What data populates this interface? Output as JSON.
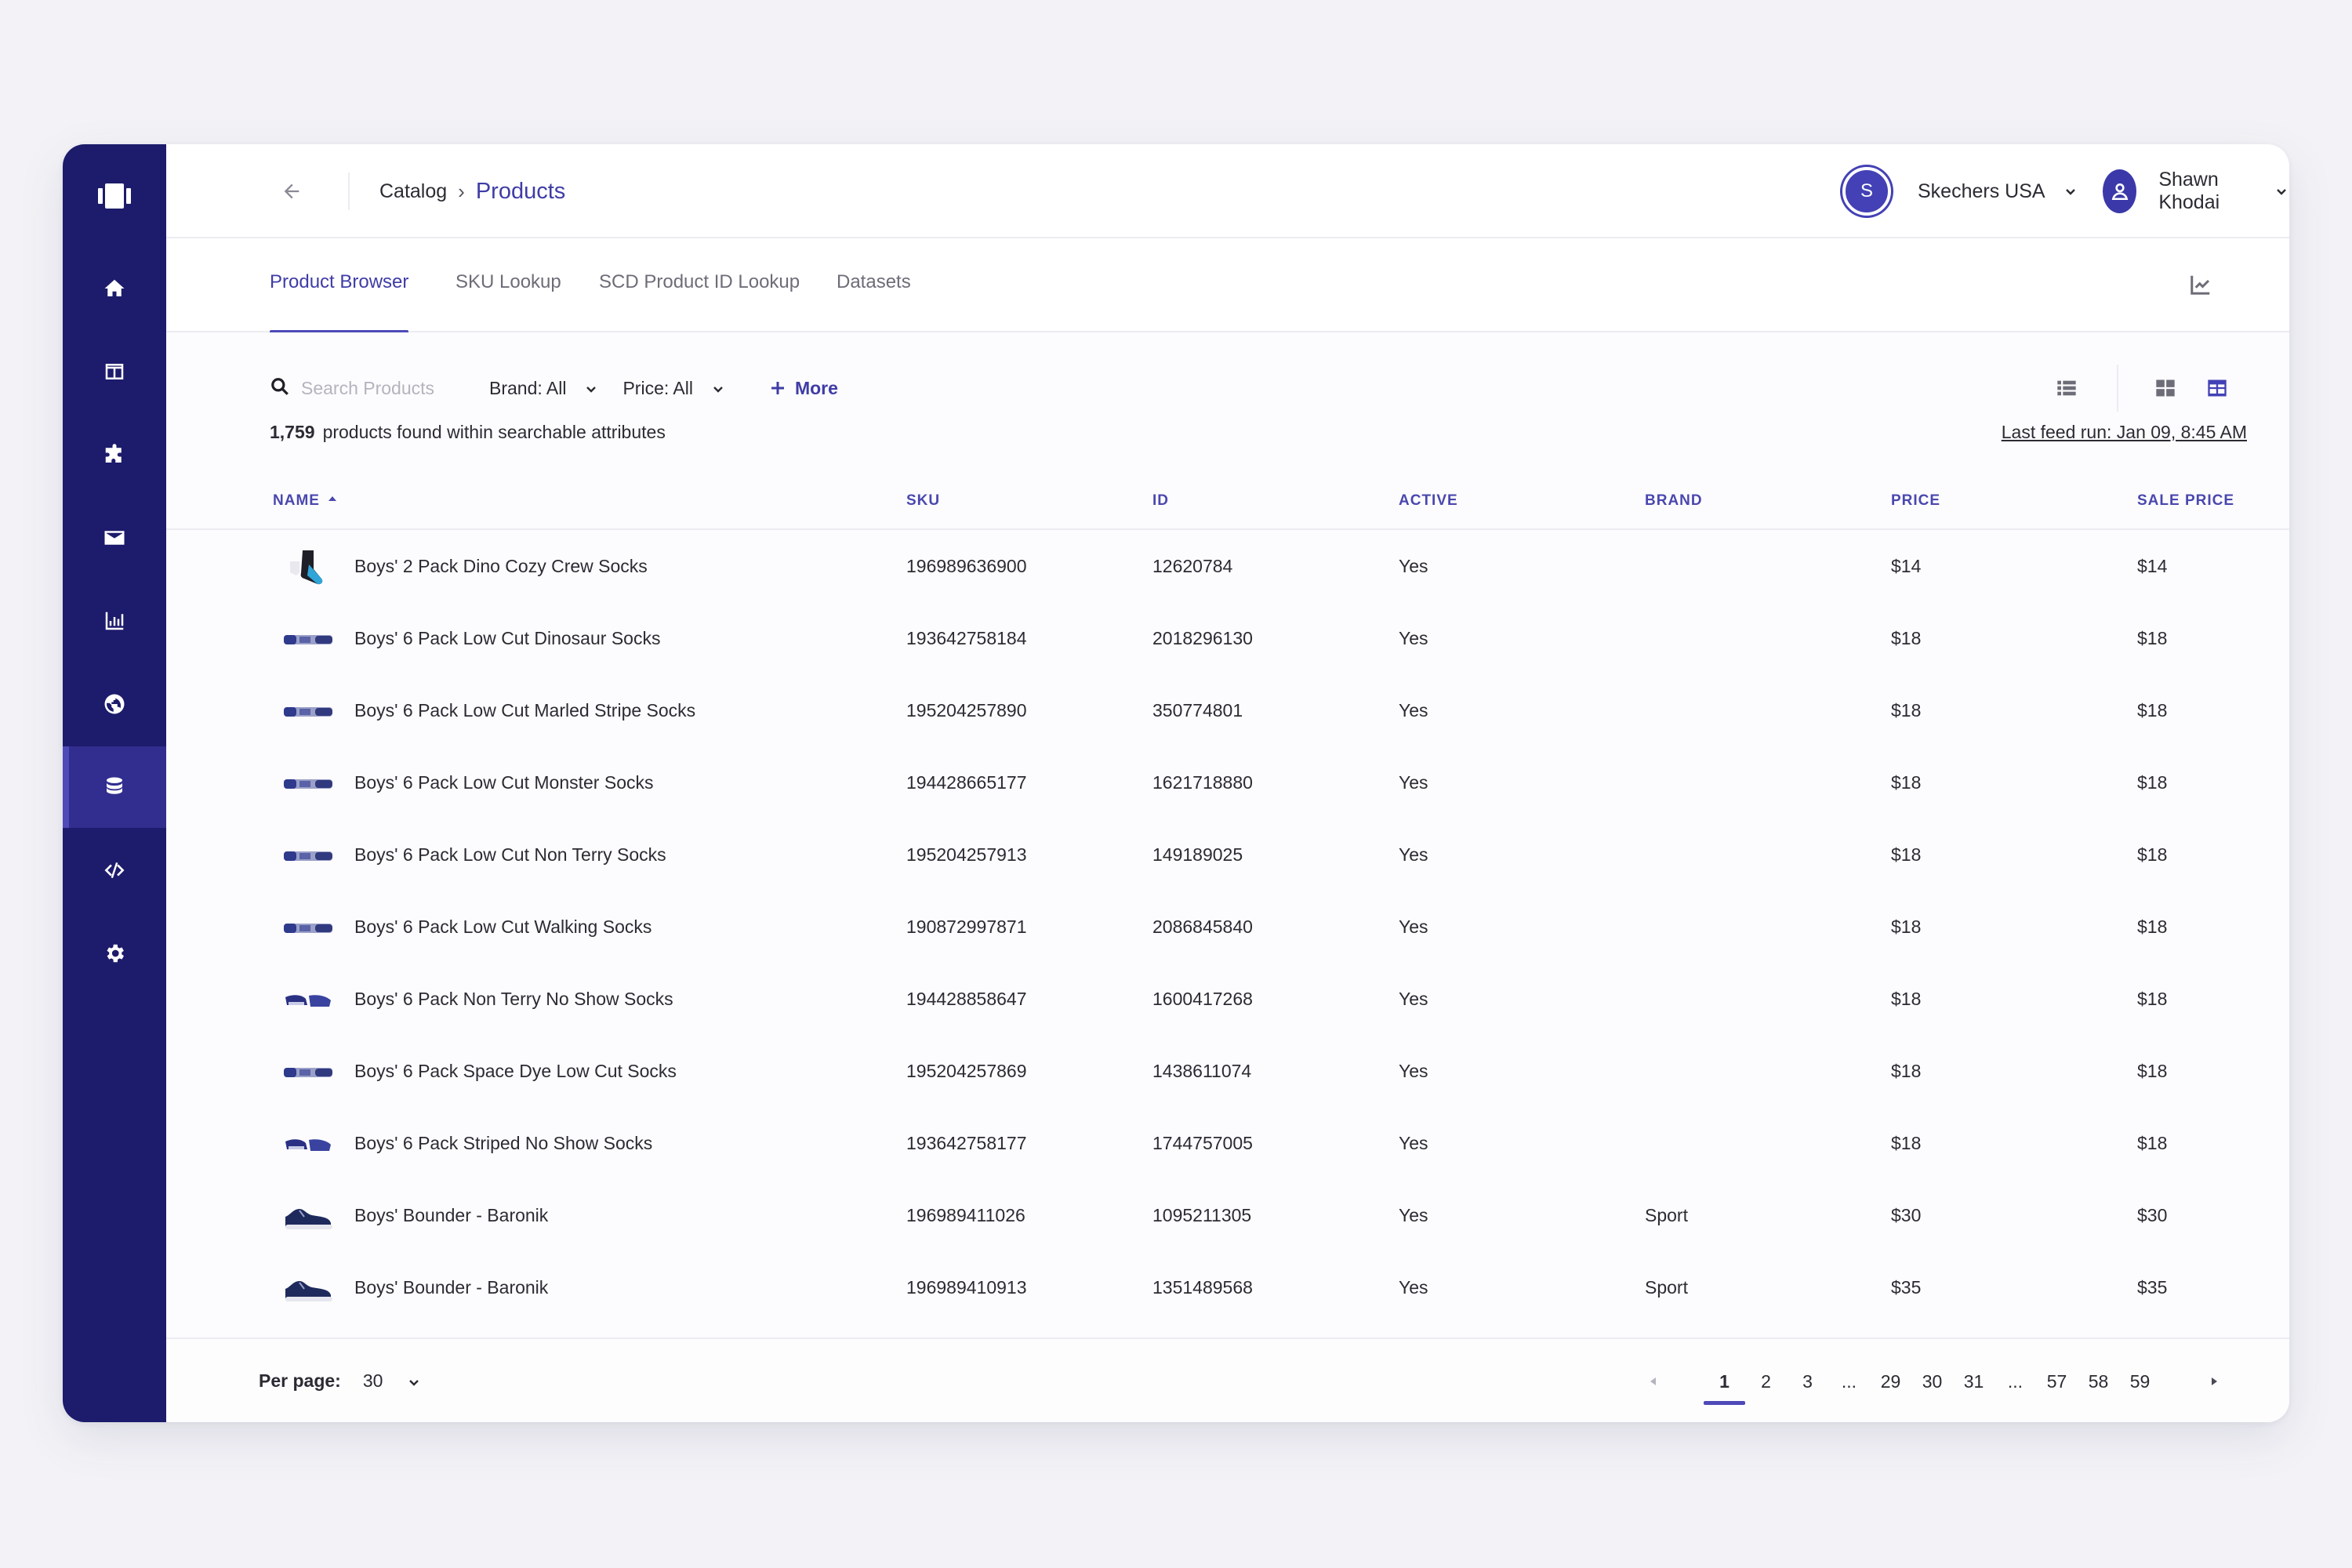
{
  "header": {
    "breadcrumb_parent": "Catalog",
    "breadcrumb_sep": "›",
    "breadcrumb_current": "Products",
    "org_initial": "S",
    "org_name": "Skechers USA",
    "user_name": "Shawn Khodai"
  },
  "tabs": [
    {
      "label": "Product Browser"
    },
    {
      "label": "SKU Lookup"
    },
    {
      "label": "SCD Product ID Lookup"
    },
    {
      "label": "Datasets"
    }
  ],
  "toolbar": {
    "search_placeholder": "Search Products",
    "brand_filter": "Brand: All",
    "price_filter": "Price: All",
    "more_label": "More"
  },
  "summary": {
    "count": "1,759",
    "text": "products found within searchable attributes",
    "last_feed": "Last feed run: Jan 09, 8:45 AM"
  },
  "columns": [
    "NAME",
    "SKU",
    "ID",
    "ACTIVE",
    "BRAND",
    "PRICE",
    "SALE PRICE"
  ],
  "rows": [
    {
      "name": "Boys' 2 Pack Dino Cozy Crew Socks",
      "sku": "196989636900",
      "id": "12620784",
      "active": "Yes",
      "brand": "",
      "price": "$14",
      "sale_price": "$14"
    },
    {
      "name": "Boys' 6 Pack Low Cut Dinosaur Socks",
      "sku": "193642758184",
      "id": "2018296130",
      "active": "Yes",
      "brand": "",
      "price": "$18",
      "sale_price": "$18"
    },
    {
      "name": "Boys' 6 Pack Low Cut Marled Stripe Socks",
      "sku": "195204257890",
      "id": "350774801",
      "active": "Yes",
      "brand": "",
      "price": "$18",
      "sale_price": "$18"
    },
    {
      "name": "Boys' 6 Pack Low Cut Monster Socks",
      "sku": "194428665177",
      "id": "1621718880",
      "active": "Yes",
      "brand": "",
      "price": "$18",
      "sale_price": "$18"
    },
    {
      "name": "Boys' 6 Pack Low Cut Non Terry Socks",
      "sku": "195204257913",
      "id": "149189025",
      "active": "Yes",
      "brand": "",
      "price": "$18",
      "sale_price": "$18"
    },
    {
      "name": "Boys' 6 Pack Low Cut Walking Socks",
      "sku": "190872997871",
      "id": "2086845840",
      "active": "Yes",
      "brand": "",
      "price": "$18",
      "sale_price": "$18"
    },
    {
      "name": "Boys' 6 Pack Non Terry No Show Socks",
      "sku": "194428858647",
      "id": "1600417268",
      "active": "Yes",
      "brand": "",
      "price": "$18",
      "sale_price": "$18"
    },
    {
      "name": "Boys' 6 Pack Space Dye Low Cut Socks",
      "sku": "195204257869",
      "id": "1438611074",
      "active": "Yes",
      "brand": "",
      "price": "$18",
      "sale_price": "$18"
    },
    {
      "name": "Boys' 6 Pack Striped No Show Socks",
      "sku": "193642758177",
      "id": "1744757005",
      "active": "Yes",
      "brand": "",
      "price": "$18",
      "sale_price": "$18"
    },
    {
      "name": "Boys' Bounder - Baronik",
      "sku": "196989411026",
      "id": "1095211305",
      "active": "Yes",
      "brand": "Sport",
      "price": "$30",
      "sale_price": "$30"
    },
    {
      "name": "Boys' Bounder - Baronik",
      "sku": "196989410913",
      "id": "1351489568",
      "active": "Yes",
      "brand": "Sport",
      "price": "$35",
      "sale_price": "$35"
    }
  ],
  "footer": {
    "per_page_label": "Per page:",
    "per_page_value": "30",
    "pages": [
      "1",
      "2",
      "3",
      "...",
      "29",
      "30",
      "31",
      "...",
      "57",
      "58",
      "59"
    ],
    "current_page": "1"
  },
  "colors": {
    "sidebar": "#1d1b6b",
    "accent": "#3f3ca6"
  },
  "icons": {
    "sidebar": [
      "logo-icon",
      "home-icon",
      "layout-icon",
      "puzzle-icon",
      "mail-icon",
      "bar-chart-icon",
      "globe-icon",
      "database-icon",
      "code-icon",
      "gear-icon"
    ],
    "thumbnails": [
      "crew-sock-icon",
      "low-cut-sock-icon",
      "low-cut-sock-icon",
      "low-cut-sock-icon",
      "low-cut-sock-icon",
      "low-cut-sock-icon",
      "no-show-sock-icon",
      "low-cut-sock-icon",
      "no-show-sock-icon",
      "sneaker-icon",
      "sneaker-icon"
    ]
  }
}
